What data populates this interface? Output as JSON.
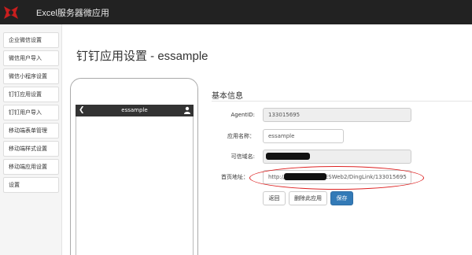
{
  "app": {
    "title": "Excel服务器微应用",
    "logo_icon": "excel-server-logo"
  },
  "sidebar": {
    "items": [
      {
        "label": "企业微信设置"
      },
      {
        "label": "微信用户导入"
      },
      {
        "label": "微信小程序设置"
      },
      {
        "label": "钉钉应用设置"
      },
      {
        "label": "钉钉用户导入"
      },
      {
        "label": "移动端表单管理"
      },
      {
        "label": "移动端样式设置"
      },
      {
        "label": "移动端应用设置"
      },
      {
        "label": "设置"
      }
    ]
  },
  "page": {
    "title": "钉钉应用设置 - essample"
  },
  "phone": {
    "back_icon": "chevron-left-icon",
    "title": "essample",
    "user_icon": "user-icon"
  },
  "form": {
    "section_title": "基本信息",
    "agent_id": {
      "label": "AgentID:",
      "value": "133015695"
    },
    "app_name": {
      "label": "应用名称：",
      "value": "essample"
    },
    "domain": {
      "label": "可信域名:",
      "value": ""
    },
    "homepage": {
      "label": "首页地址：",
      "value_prefix": "http://",
      "value_suffix": "/IESWeb2/DingLink/133015695"
    }
  },
  "buttons": {
    "back": "返回",
    "delete": "删除此应用",
    "save": "保存"
  },
  "colors": {
    "topbar": "#222222",
    "primary": "#337ab7",
    "annotation": "#dd2222"
  }
}
